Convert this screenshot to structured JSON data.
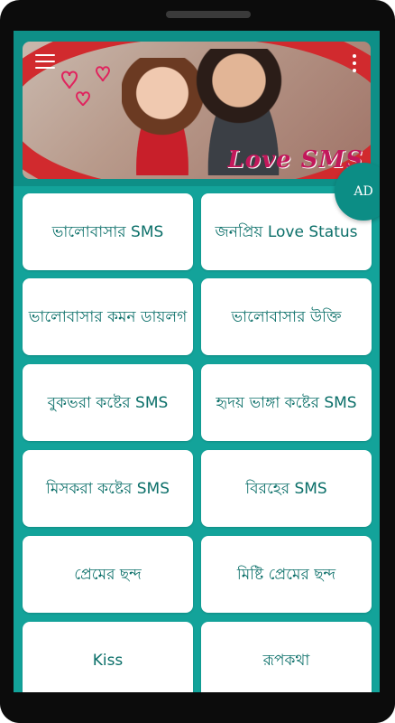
{
  "banner": {
    "title_text": "Love SMS"
  },
  "ad": {
    "label": "AD"
  },
  "categories": [
    {
      "label": "ভালোবাসার SMS"
    },
    {
      "label": "জনপ্রিয় Love Status"
    },
    {
      "label": "ভালোবাসার কমন ডায়লগ"
    },
    {
      "label": "ভালোবাসার উক্তি"
    },
    {
      "label": "বুকভরা কষ্টের SMS"
    },
    {
      "label": "হৃদয় ভাঙ্গা কষ্টের SMS"
    },
    {
      "label": "মিসকরা কষ্টের SMS"
    },
    {
      "label": "বিরহের SMS"
    },
    {
      "label": "প্রেমের ছন্দ"
    },
    {
      "label": "মিষ্টি প্রেমের ছন্দ"
    },
    {
      "label": "Kiss"
    },
    {
      "label": "রূপকথা"
    }
  ],
  "icons": {
    "menu": "hamburger-menu-icon",
    "more": "more-vertical-icon",
    "hearts": "hearts-icon"
  },
  "colors": {
    "background": "#13a39a",
    "card_text": "#0b6f69",
    "ad_button": "#0c8d85",
    "banner_title": "#c2185b"
  }
}
